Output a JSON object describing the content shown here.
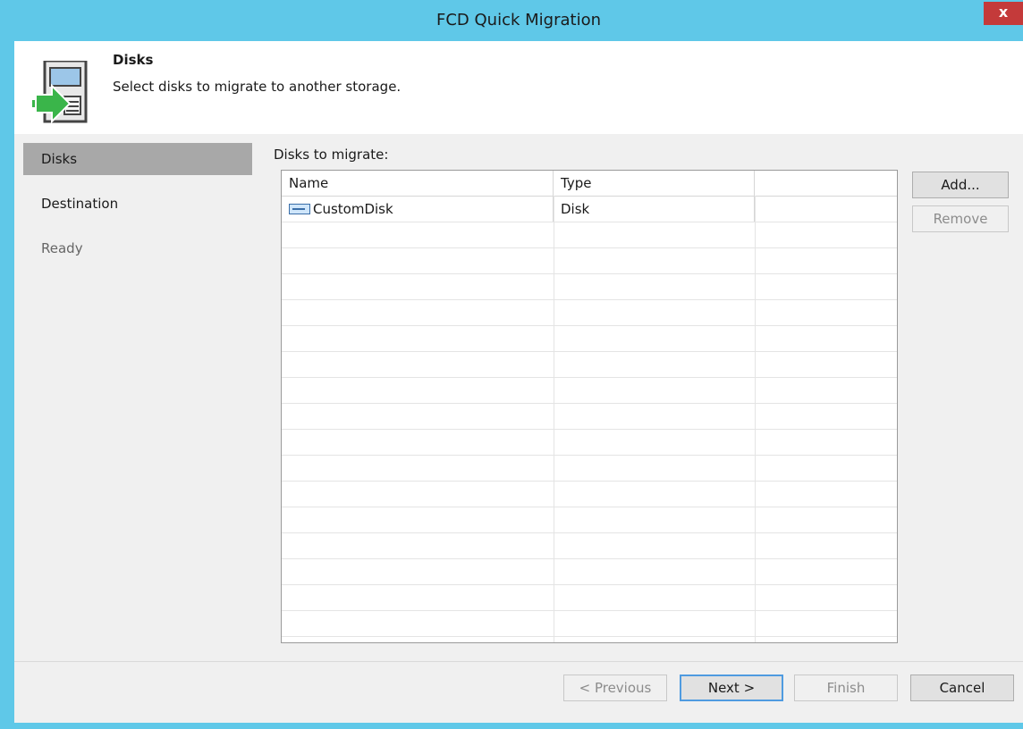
{
  "window": {
    "title": "FCD Quick Migration",
    "close_label": "x"
  },
  "header": {
    "title": "Disks",
    "subtitle": "Select disks to migrate to another storage."
  },
  "nav": {
    "items": [
      {
        "label": "Disks",
        "state": "active"
      },
      {
        "label": "Destination",
        "state": "normal"
      },
      {
        "label": "Ready",
        "state": "disabled"
      }
    ]
  },
  "main": {
    "list_label": "Disks to migrate:",
    "columns": [
      "Name",
      "Type",
      ""
    ],
    "rows": [
      {
        "name": "CustomDisk",
        "type": "Disk",
        "icon": "disk-icon"
      }
    ],
    "add_label": "Add...",
    "remove_label": "Remove"
  },
  "footer": {
    "previous_label": "< Previous",
    "next_label": "Next >",
    "finish_label": "Finish",
    "cancel_label": "Cancel"
  },
  "colors": {
    "titlebar": "#5fc8e8",
    "close": "#c43a3a",
    "nav_active": "#a8a8a8",
    "accent_icon": "#3ab54a"
  }
}
